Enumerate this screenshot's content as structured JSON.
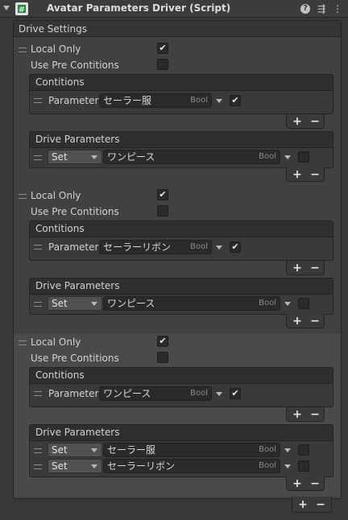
{
  "header": {
    "script_icon": "#",
    "title": "Avatar Parameters Driver (Script)",
    "help_icon": "?",
    "settings_icon": "⇶",
    "more_icon": "⋮"
  },
  "drive_settings": {
    "label": "Drive Settings",
    "entries": [
      {
        "local_only_label": "Local Only",
        "local_only": true,
        "use_pre_label": "Use Pre Contitions",
        "use_pre": false,
        "conditions": {
          "label": "Contitions",
          "items": [
            {
              "param_label": "Parameter",
              "value": "セーラー服",
              "type": "Bool",
              "checked": true
            }
          ]
        },
        "drive_params": {
          "label": "Drive Parameters",
          "items": [
            {
              "mode": "Set",
              "value": "ワンピース",
              "type": "Bool",
              "checked": false
            }
          ]
        }
      },
      {
        "local_only_label": "Local Only",
        "local_only": true,
        "use_pre_label": "Use Pre Contitions",
        "use_pre": false,
        "conditions": {
          "label": "Contitions",
          "items": [
            {
              "param_label": "Parameter",
              "value": "セーラーリボン",
              "type": "Bool",
              "checked": true
            }
          ]
        },
        "drive_params": {
          "label": "Drive Parameters",
          "items": [
            {
              "mode": "Set",
              "value": "ワンピース",
              "type": "Bool",
              "checked": false
            }
          ]
        }
      },
      {
        "local_only_label": "Local Only",
        "local_only": true,
        "use_pre_label": "Use Pre Contitions",
        "use_pre": false,
        "conditions": {
          "label": "Contitions",
          "items": [
            {
              "param_label": "Parameter",
              "value": "ワンピース",
              "type": "Bool",
              "checked": true
            }
          ]
        },
        "drive_params": {
          "label": "Drive Parameters",
          "items": [
            {
              "mode": "Set",
              "value": "セーラー服",
              "type": "Bool",
              "checked": false
            },
            {
              "mode": "Set",
              "value": "セーラーリボン",
              "type": "Bool",
              "checked": false
            }
          ]
        }
      }
    ]
  },
  "controls": {
    "plus": "+",
    "minus": "−",
    "check": "✔"
  }
}
